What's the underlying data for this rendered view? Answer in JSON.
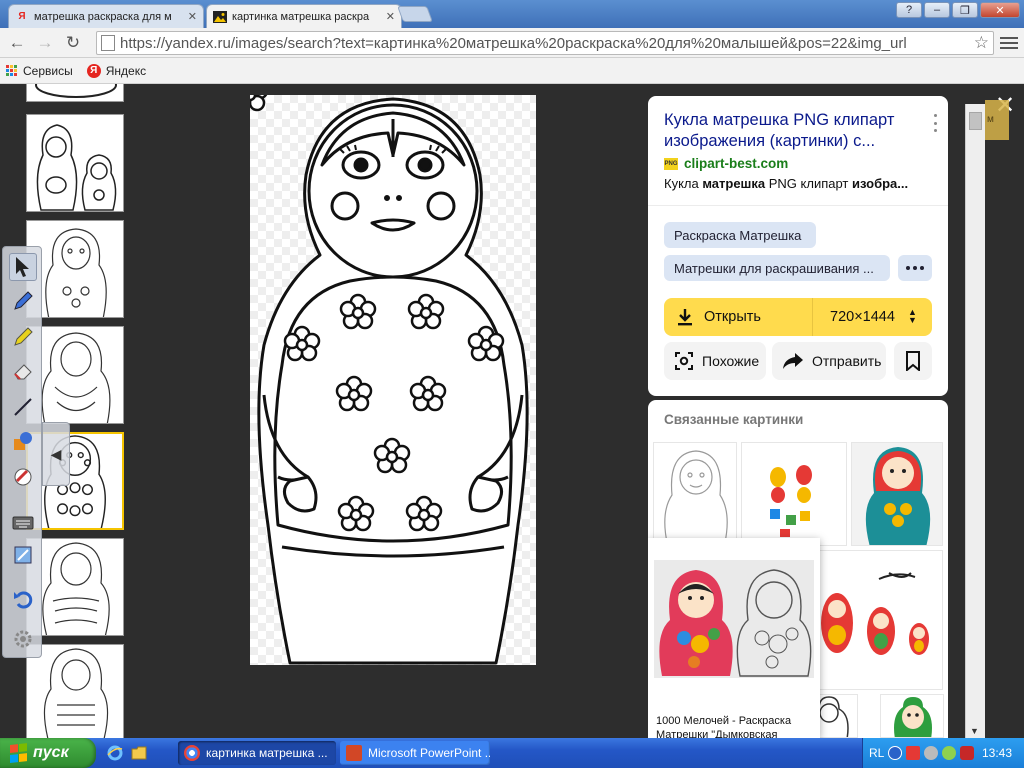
{
  "browser": {
    "tabs": [
      {
        "title": "матрешка раскраска для м",
        "favicon": "yandex-icon"
      },
      {
        "title": "картинка матрешка раскра",
        "favicon": "images-icon",
        "active": true
      }
    ],
    "window_controls": {
      "help": "?",
      "minimize": "–",
      "restore": "❐",
      "close": "✕"
    },
    "nav": {
      "back": "←",
      "forward": "→",
      "reload": "↻"
    },
    "url": "https://yandex.ru/images/search?text=картинка%20матрешка%20раскраска%20для%20малышей&pos=22&img_url",
    "bookmarks": [
      {
        "label": "Сервисы",
        "icon": "apps-grid-icon"
      },
      {
        "label": "Яндекс",
        "icon": "yandex-icon",
        "glyph": "Я"
      }
    ]
  },
  "viewer": {
    "close_glyph": "✕",
    "scroll_badge": "м",
    "panel": {
      "title": "Кукла матрешка PNG клипарт изображения (картинки) с...",
      "site": "clipart-best.com",
      "site_badge": "PNG",
      "description_parts": [
        "Кукла ",
        "матрешка",
        " PNG клипарт ",
        "изобра..."
      ],
      "tags": [
        "Раскраска Матрешка",
        "Матрешки для раскрашивания ..."
      ],
      "open_label": "Открыть",
      "size_label": "720×1444",
      "similar_label": "Похожие",
      "share_label": "Отправить"
    },
    "related": {
      "title": "Связанные картинки",
      "tooltip_text": "1000 Мелочей - Раскраска Матрешки \"Дымковская"
    }
  },
  "taskbar": {
    "start_label": "пуск",
    "tasks": [
      {
        "label": "картинка матрешка ...",
        "active": true
      },
      {
        "label": "Microsoft PowerPoint ...",
        "active": false
      }
    ],
    "tray_lang": "RL",
    "clock": "13:43"
  },
  "colors": {
    "accent_yellow": "#ffdb4d",
    "link_blue": "#0b1a8c",
    "site_green": "#1a7e1a",
    "chip_bg": "#dbe5f4",
    "viewer_bg": "#2d2d2d",
    "taskbar_blue": "#2457c7",
    "start_green": "#3a9e3a"
  }
}
